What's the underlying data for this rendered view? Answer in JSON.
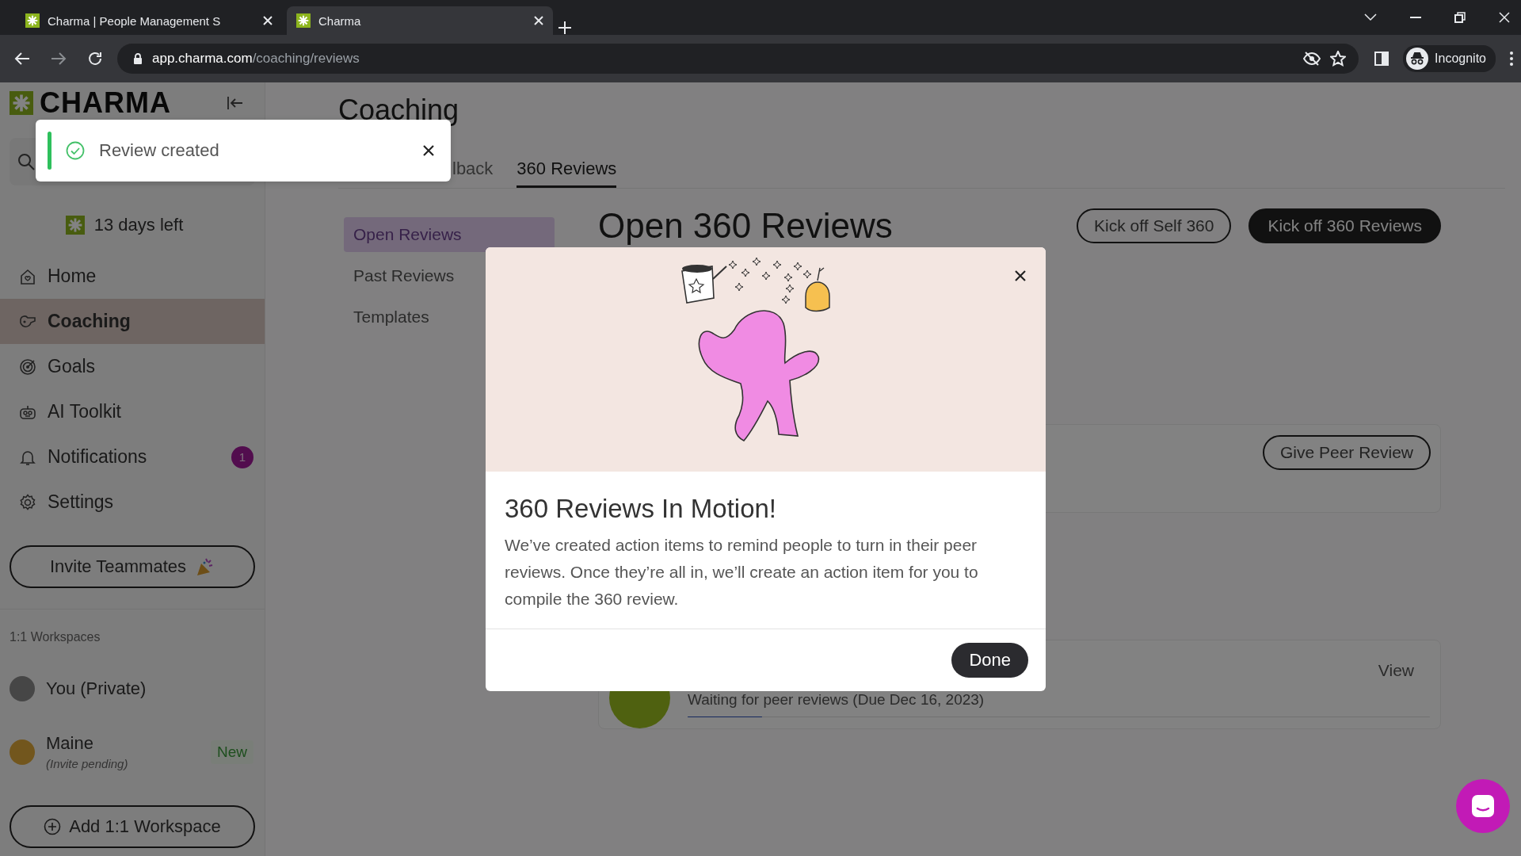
{
  "browser": {
    "tabs": [
      {
        "title": "Charma | People Management S",
        "selected": false
      },
      {
        "title": "Charma",
        "selected": true
      }
    ],
    "url_host": "app.charma.com",
    "url_path": "/coaching/reviews",
    "profile": "Incognito"
  },
  "sidebar": {
    "logo": "CHARMA",
    "trial": "13 days left",
    "nav": [
      {
        "label": "Home",
        "selected": false
      },
      {
        "label": "Coaching",
        "selected": true
      },
      {
        "label": "Goals",
        "selected": false
      },
      {
        "label": "AI Toolkit",
        "selected": false
      },
      {
        "label": "Notifications",
        "selected": false,
        "badge": "1"
      },
      {
        "label": "Settings",
        "selected": false
      }
    ],
    "invite_button": "Invite Teammates",
    "workspaces_heading": "1:1 Workspaces",
    "workspaces": [
      {
        "name": "You (Private)"
      },
      {
        "name": "Maine",
        "note": "(Invite pending)",
        "badge": "New"
      }
    ],
    "add_button": "Add 1:1 Workspace"
  },
  "main": {
    "title": "Coaching",
    "tabs": [
      {
        "label": "lback",
        "selected": false
      },
      {
        "label": "360 Reviews",
        "selected": true
      }
    ],
    "subnav": [
      {
        "label": "Open Reviews",
        "selected": true
      },
      {
        "label": "Past Reviews",
        "selected": false
      },
      {
        "label": "Templates",
        "selected": false
      }
    ],
    "heading": "Open 360 Reviews",
    "actions": [
      {
        "label": "Kick off Self 360",
        "kind": "outline"
      },
      {
        "label": "Kick off 360 Reviews",
        "kind": "filled"
      }
    ],
    "cards": [
      {
        "kind": "peer_review",
        "action": "Give Peer Review"
      },
      {
        "kind": "progress",
        "link": "View",
        "status": "Waiting for peer reviews (Due Dec 16, 2023)",
        "level": 0.1
      }
    ]
  },
  "toast": {
    "message": "Review created"
  },
  "modal": {
    "title": "360 Reviews In Motion!",
    "body": "We’ve created action items to remind people to turn in their peer reviews. Once they’re all in, we’ll create an action item for you to compile the 360 review.",
    "button": "Done"
  }
}
